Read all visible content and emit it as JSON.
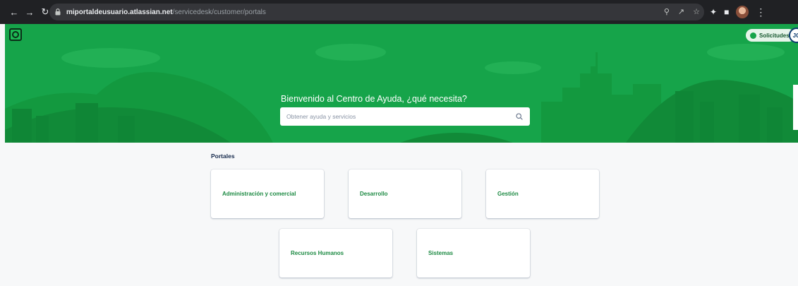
{
  "browser": {
    "url_host": "miportaldeusuario.atlassian.net",
    "url_path": "/servicedesk/customer/portals"
  },
  "header": {
    "requests_label": "Solicitudes",
    "avatar_initials": "JG"
  },
  "hero": {
    "welcome_text": "Bienvenido al Centro de Ayuda, ¿qué necesita?",
    "search_placeholder": "Obtener ayuda y servicios"
  },
  "portals": {
    "title": "Portales",
    "items": [
      {
        "label": "Administración y comercial"
      },
      {
        "label": "Desarrollo"
      },
      {
        "label": "Gestión"
      },
      {
        "label": "Recursos Humanos"
      },
      {
        "label": "Sistemas"
      }
    ]
  },
  "colors": {
    "brand_green": "#16a44a",
    "link_green": "#1d8a43",
    "chrome_dark": "#202124"
  }
}
